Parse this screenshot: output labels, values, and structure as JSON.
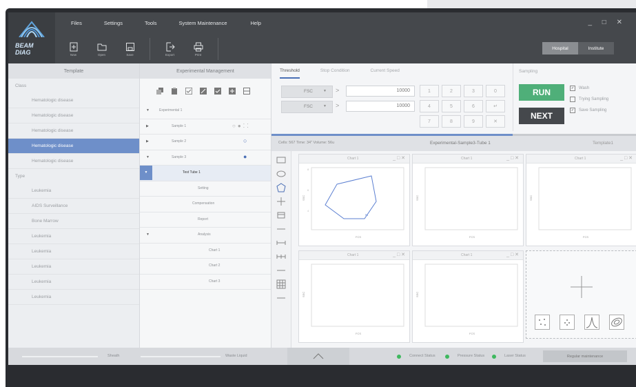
{
  "menu": [
    "Files",
    "Settings",
    "Tools",
    "System Maintenance",
    "Help"
  ],
  "logo": {
    "line1": "BEAM",
    "line2": "DIAG"
  },
  "toolbar": [
    {
      "label": "New",
      "icon": "new-file-icon"
    },
    {
      "label": "Open",
      "icon": "folder-icon"
    },
    {
      "label": "Save",
      "icon": "save-icon"
    },
    {
      "label": "Export",
      "icon": "export-icon"
    },
    {
      "label": "Print",
      "icon": "printer-icon"
    }
  ],
  "window_controls": "_ □ ✕",
  "mode": {
    "hospital": "Hospital",
    "institute": "Institute"
  },
  "template": {
    "header": "Template",
    "class_label": "Class",
    "class_items": [
      "Hematologic disease",
      "Hematologic disease",
      "Hematologic disease",
      "Hematologic disease",
      "Hematologic disease"
    ],
    "selected_class_index": 3,
    "type_label": "Type",
    "type_items": [
      "Leukemia",
      "AIDS Surveillance",
      "Bone Marrow",
      "Leukemia",
      "Leukemia",
      "Leukemia",
      "Leukemia",
      "Leukemia"
    ]
  },
  "experiment": {
    "header": "Experimental Management",
    "tree": [
      {
        "label": "Experimental 1",
        "arrow": "▼",
        "level": 0
      },
      {
        "label": "Sample 1",
        "arrow": "▶",
        "level": 1
      },
      {
        "label": "Sample 2",
        "arrow": "▶",
        "level": 1
      },
      {
        "label": "Sample 3",
        "arrow": "▼",
        "level": 1
      },
      {
        "label": "Test Tube 1",
        "arrow": "▼",
        "level": 2,
        "selected": true
      },
      {
        "label": "Setting",
        "arrow": "",
        "level": 3
      },
      {
        "label": "Compensation",
        "arrow": "",
        "level": 3
      },
      {
        "label": "Report",
        "arrow": "",
        "level": 3
      },
      {
        "label": "Analysis",
        "arrow": "▼",
        "level": 3
      },
      {
        "label": "Chart 1",
        "arrow": "",
        "level": 4
      },
      {
        "label": "Chart 2",
        "arrow": "",
        "level": 4
      },
      {
        "label": "Chart 3",
        "arrow": "",
        "level": 4
      }
    ]
  },
  "tabs": [
    "Threshold",
    "Stop Condition",
    "Current Speed"
  ],
  "threshold": {
    "row1": {
      "channel": "FSC",
      "op": ">",
      "value": "10000"
    },
    "row2": {
      "channel": "FSC",
      "op": ">",
      "value": "10000"
    }
  },
  "keypad": [
    "1",
    "2",
    "3",
    "0",
    "4",
    "5",
    "6",
    "↵",
    "7",
    "8",
    "9",
    "✕"
  ],
  "sampling": {
    "title": "Sampling",
    "run": "RUN",
    "next": "NEXT",
    "checks": [
      {
        "label": "Wash",
        "checked": true
      },
      {
        "label": "Trying Sampling",
        "checked": false
      },
      {
        "label": "Save Sampling",
        "checked": true
      }
    ]
  },
  "info": {
    "cells": "Cells: 567   Time: 34\"   Volume: 56u",
    "title": "Experimental-Sample3-Tube 1",
    "template": "Template1"
  },
  "charts": [
    {
      "name": "Chart 1",
      "xlabel": "FCS",
      "ylabel": "SSC"
    },
    {
      "name": "Chart 1",
      "xlabel": "FCS",
      "ylabel": "SSC"
    },
    {
      "name": "Chart 1",
      "xlabel": "FCS",
      "ylabel": "SSC"
    },
    {
      "name": "Chart 1",
      "xlabel": "FCS",
      "ylabel": "SSC"
    },
    {
      "name": "Chart 1",
      "xlabel": "FCS",
      "ylabel": "SSC"
    }
  ],
  "status": {
    "sheath": "Sheath",
    "waste": "Waste Liquid",
    "connect": "Connect Status",
    "pressure": "Pressure Status",
    "laser": "Laser Status",
    "maintenance": "Regular maintenance"
  },
  "colors": {
    "accent": "#6e8fc9",
    "run": "#4faf79",
    "status_ok": "#3fb85f",
    "topbar": "#45484c"
  }
}
